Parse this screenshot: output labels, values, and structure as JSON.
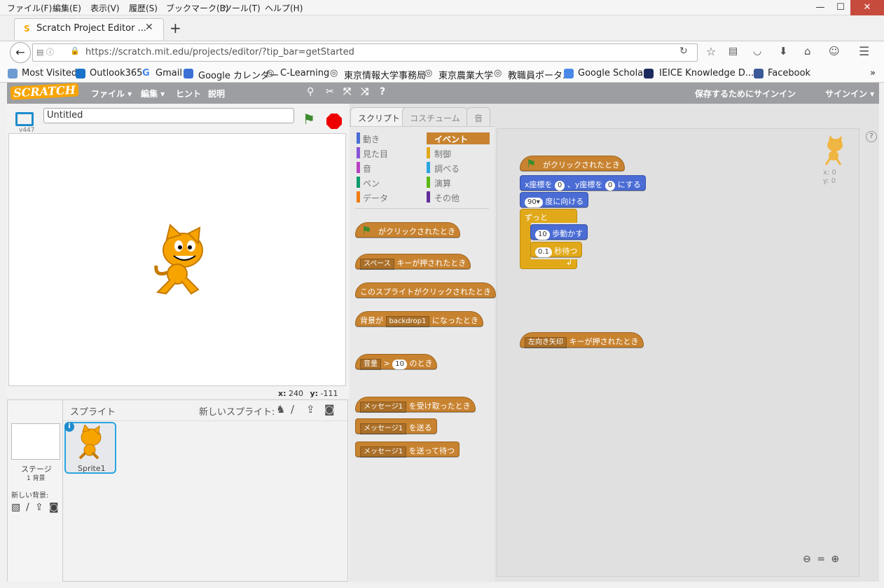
{
  "browser": {
    "menu": [
      "ファイル(F)",
      "編集(E)",
      "表示(V)",
      "履歴(S)",
      "ブックマーク(B)",
      "ツール(T)",
      "ヘルプ(H)"
    ],
    "tab_title": "Scratch Project Editor ...",
    "url": "https://scratch.mit.edu/projects/editor/?tip_bar=getStarted",
    "bookmarks": [
      "Most Visited",
      "Outlook365",
      "Gmail",
      "Google カレンダー",
      "C-Learning",
      "東京情報大学事務局",
      "東京農業大学",
      "教職員ポータル",
      "Google Scholar",
      "IEICE Knowledge D...",
      "Facebook"
    ],
    "window_buttons": [
      "—",
      "☐",
      "✕"
    ]
  },
  "scratch": {
    "logo": "SCRATCH",
    "menu": [
      "ファイル ▾",
      "編集 ▾",
      "ヒント",
      "説明"
    ],
    "signin_save": "保存するためにサインイン",
    "signin": "サインイン ▾",
    "version": "v447",
    "project_title": "Untitled",
    "stage_x_label": "x:",
    "stage_x": "240",
    "stage_y_label": "y:",
    "stage_y": "-111",
    "sprites_label": "スプライト",
    "new_sprite_label": "新しいスプライト:",
    "stage_label": "ステージ",
    "stage_backdrops": "1 背景",
    "new_backdrop_label": "新しい背景:",
    "sprite_name": "Sprite1",
    "tabs": [
      "スクリプト",
      "コスチューム",
      "音"
    ],
    "categories_left": [
      "動き",
      "見た目",
      "音",
      "ペン",
      "データ"
    ],
    "categories_right": [
      "イベント",
      "制御",
      "調べる",
      "演算",
      "その他"
    ],
    "palette": {
      "b1": "がクリックされたとき",
      "b2_dd": "スペース",
      "b2": "キーが押されたとき",
      "b3": "このスプライトがクリックされたとき",
      "b4_pre": "背景が",
      "b4_dd": "backdrop1",
      "b4": "になったとき",
      "b5_dd": "音量",
      "b5_op": ">",
      "b5_val": "10",
      "b5": "のとき",
      "b6_dd": "メッセージ1",
      "b6": "を受け取ったとき",
      "b7_dd": "メッセージ1",
      "b7": "を送る",
      "b8_dd": "メッセージ1",
      "b8": "を送って待つ"
    },
    "script": {
      "hat": "がクリックされたとき",
      "goto_x": "x座標を",
      "goto_xv": "0",
      "goto_y": "、y座標を",
      "goto_yv": "0",
      "goto_end": "にする",
      "dir_val": "90▾",
      "dir": "度に向ける",
      "forever": "ずっと",
      "move_val": "10",
      "move": "歩動かす",
      "wait_val": "0.1",
      "wait": "秒待つ",
      "key_dd": "左向き矢印",
      "key": "キーが押されたとき"
    },
    "sprite_xy": [
      "x: 0",
      "y: 0"
    ],
    "colors": {
      "events": "#c88330",
      "motion": "#4a6cd4",
      "control": "#e1a91a",
      "topbar": "#9c9ea2"
    }
  }
}
